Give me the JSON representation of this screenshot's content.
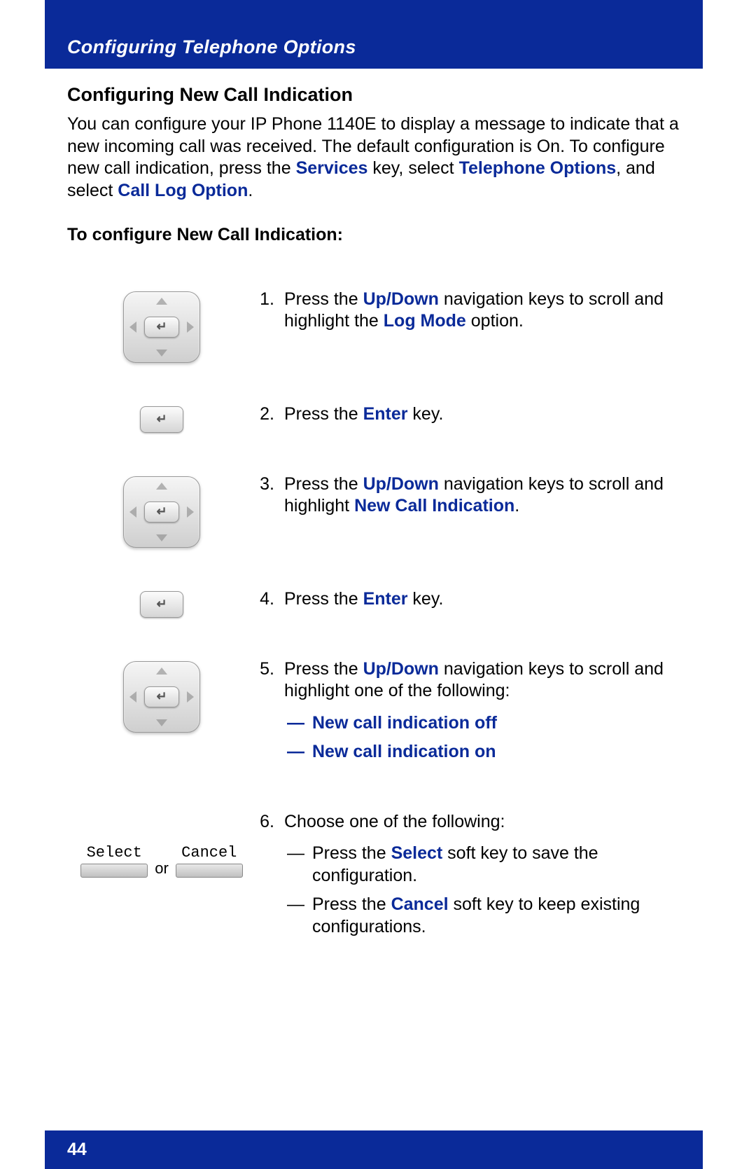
{
  "header": {
    "title": "Configuring Telephone Options"
  },
  "section": {
    "title": "Configuring New Call Indication",
    "intro_part1": "You can configure your IP Phone 1140E to display a message to indicate that a new incoming call was received. The default configuration is On. To configure new call indication, press the ",
    "kw_services": "Services",
    "intro_part2": " key, select ",
    "kw_tel_opts": "Telephone Options",
    "intro_part3": ", and select ",
    "kw_call_log": "Call Log Option",
    "intro_part4": ".",
    "sub_head": "To configure New Call Indication:"
  },
  "steps": [
    {
      "num": "1.",
      "icon": "nav-pad",
      "segments": [
        {
          "t": "Press the ",
          "c": ""
        },
        {
          "t": "Up/Down",
          "c": "blue"
        },
        {
          "t": " navigation keys to scroll and highlight the ",
          "c": ""
        },
        {
          "t": "Log Mode",
          "c": "blue"
        },
        {
          "t": " option.",
          "c": ""
        }
      ]
    },
    {
      "num": "2.",
      "icon": "enter-key",
      "segments": [
        {
          "t": "Press the ",
          "c": ""
        },
        {
          "t": "Enter",
          "c": "blue"
        },
        {
          "t": " key.",
          "c": ""
        }
      ]
    },
    {
      "num": "3.",
      "icon": "nav-pad",
      "segments": [
        {
          "t": "Press the ",
          "c": ""
        },
        {
          "t": "Up/Down",
          "c": "blue"
        },
        {
          "t": " navigation keys to scroll and highlight ",
          "c": ""
        },
        {
          "t": "New Call Indication",
          "c": "blue"
        },
        {
          "t": ".",
          "c": ""
        }
      ]
    },
    {
      "num": "4.",
      "icon": "enter-key",
      "segments": [
        {
          "t": "Press the ",
          "c": ""
        },
        {
          "t": "Enter",
          "c": "blue"
        },
        {
          "t": " key.",
          "c": ""
        }
      ]
    },
    {
      "num": "5.",
      "icon": "nav-pad",
      "segments": [
        {
          "t": "Press the ",
          "c": ""
        },
        {
          "t": "Up/Down",
          "c": "blue"
        },
        {
          "t": " navigation keys to scroll and highlight one of the following:",
          "c": ""
        }
      ],
      "sublist": [
        {
          "dash": "—",
          "text": "New call indication off",
          "style": "blue"
        },
        {
          "dash": "—",
          "text": "New call indication on",
          "style": "blue"
        }
      ]
    },
    {
      "num": "6.",
      "icon": "softkeys",
      "segments": [
        {
          "t": "Choose one of the following:",
          "c": ""
        }
      ],
      "sublist": [
        {
          "dash": "—",
          "segments": [
            {
              "t": "Press the ",
              "c": ""
            },
            {
              "t": "Select",
              "c": "blue"
            },
            {
              "t": " soft key to save the configuration.",
              "c": ""
            }
          ]
        },
        {
          "dash": "—",
          "segments": [
            {
              "t": "Press the ",
              "c": ""
            },
            {
              "t": "Cancel",
              "c": "blue"
            },
            {
              "t": " soft key to keep existing configurations.",
              "c": ""
            }
          ]
        }
      ]
    }
  ],
  "softkeys": {
    "select": "Select",
    "cancel": "Cancel",
    "or": "or"
  },
  "footer": {
    "page": "44"
  }
}
